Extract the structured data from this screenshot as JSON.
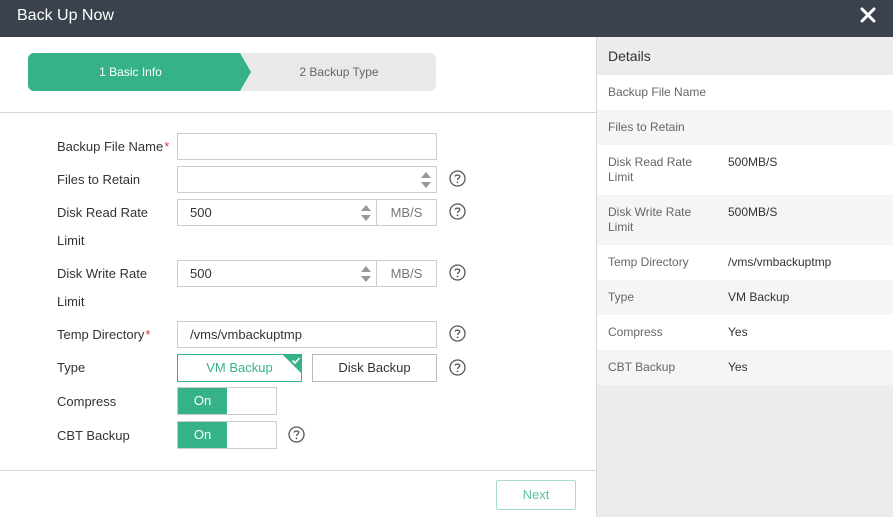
{
  "dialog": {
    "title": "Back Up Now"
  },
  "steps": [
    {
      "label": "1 Basic Info"
    },
    {
      "label": "2 Backup Type"
    }
  ],
  "form": {
    "backup_file_name": {
      "label": "Backup File Name",
      "required_mark": "*",
      "value": ""
    },
    "files_to_retain": {
      "label": "Files to Retain",
      "value": ""
    },
    "disk_read_rate": {
      "label_line1": "Disk Read Rate",
      "label_line2": "Limit",
      "value": "500",
      "unit": "MB/S"
    },
    "disk_write_rate": {
      "label_line1": "Disk Write Rate",
      "label_line2": "Limit",
      "value": "500",
      "unit": "MB/S"
    },
    "temp_directory": {
      "label": "Temp Directory",
      "required_mark": "*",
      "value": "/vms/vmbackuptmp"
    },
    "type": {
      "label": "Type",
      "options": [
        "VM Backup",
        "Disk Backup"
      ],
      "selected": "VM Backup"
    },
    "compress": {
      "label": "Compress",
      "state": "On"
    },
    "cbt_backup": {
      "label": "CBT Backup",
      "state": "On"
    }
  },
  "footer": {
    "next_label": "Next"
  },
  "details": {
    "title": "Details",
    "rows": [
      {
        "key": "Backup File Name",
        "value": ""
      },
      {
        "key": "Files to Retain",
        "value": ""
      },
      {
        "key": "Disk Read Rate Limit",
        "value": "500MB/S"
      },
      {
        "key": "Disk Write Rate Limit",
        "value": "500MB/S"
      },
      {
        "key": "Temp Directory",
        "value": "/vms/vmbackuptmp"
      },
      {
        "key": "Type",
        "value": "VM Backup"
      },
      {
        "key": "Compress",
        "value": "Yes"
      },
      {
        "key": "CBT Backup",
        "value": "Yes"
      }
    ]
  },
  "colors": {
    "accent": "#36b28a",
    "titlebar": "#39424d",
    "required": "#e4393c"
  }
}
